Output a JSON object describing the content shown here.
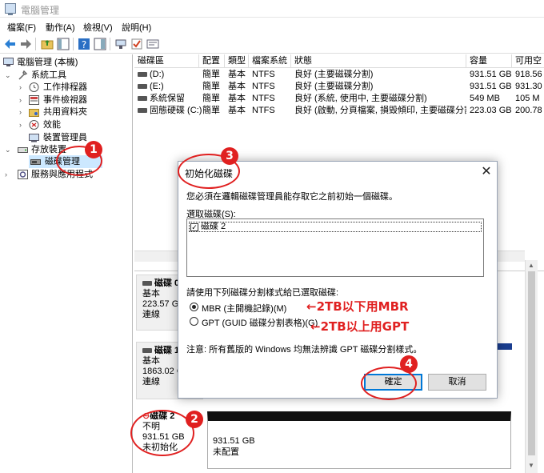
{
  "window": {
    "title": "電腦管理"
  },
  "menu": [
    "檔案(F)",
    "動作(A)",
    "檢視(V)",
    "說明(H)"
  ],
  "toolbar_icons": [
    "back-arrow-icon",
    "forward-arrow-icon",
    "folder-up-icon",
    "show-pane-icon",
    "help-icon",
    "pane-icon",
    "connect-icon",
    "check-icon",
    "properties-icon"
  ],
  "tree": {
    "root": "電腦管理 (本機)",
    "system_tools": "系統工具",
    "task_scheduler": "工作排程器",
    "event_viewer": "事件檢視器",
    "shared_folders": "共用資料夾",
    "performance": "效能",
    "device_manager": "裝置管理員",
    "storage": "存放裝置",
    "disk_management": "磁碟管理",
    "services": "服務與應用程式"
  },
  "volumes": {
    "columns": [
      "磁碟區",
      "配置",
      "類型",
      "檔案系統",
      "狀態",
      "容量",
      "可用空"
    ],
    "rows": [
      [
        "(D:)",
        "簡單",
        "基本",
        "NTFS",
        "良好 (主要磁碟分割)",
        "931.51 GB",
        "918.56"
      ],
      [
        "(E:)",
        "簡單",
        "基本",
        "NTFS",
        "良好 (主要磁碟分割)",
        "931.51 GB",
        "931.30"
      ],
      [
        "系統保留",
        "簡單",
        "基本",
        "NTFS",
        "良好 (系統, 使用中, 主要磁碟分割)",
        "549 MB",
        "105 M"
      ],
      [
        "固態硬碟 (C:)",
        "簡單",
        "基本",
        "NTFS",
        "良好 (啟動, 分頁檔案, 損毀傾印, 主要磁碟分割)",
        "223.03 GB",
        "200.78"
      ]
    ]
  },
  "disks": [
    {
      "name": "磁碟 0",
      "type": "基本",
      "size": "223.57 GE",
      "status": "連線"
    },
    {
      "name": "磁碟 1",
      "type": "基本",
      "size": "1863.02 GE",
      "status": "連線"
    },
    {
      "name": "磁碟 2",
      "type": "不明",
      "size": "931.51 GB",
      "status": "未初始化",
      "part_size": "931.51 GB",
      "part_status": "未配置"
    }
  ],
  "dialog": {
    "title": "初始化磁碟",
    "intro": "您必須在邏輯磁碟管理員能存取它之前初始一個磁碟。",
    "select_label": "選取磁碟(S):",
    "disk_item": "磁碟 2",
    "style_label": "請使用下列磁碟分割樣式給已選取磁碟:",
    "mbr": "MBR (主開機記錄)(M)",
    "gpt": "GPT (GUID 磁碟分割表格)(G)",
    "note": "注意: 所有舊版的 Windows 均無法辨識 GPT 磁碟分割樣式。",
    "ok": "確定",
    "cancel": "取消"
  },
  "annotations": {
    "b1": "1",
    "b2": "2",
    "b3": "3",
    "b4": "4",
    "mbr_hint": "←2TB以下用MBR",
    "gpt_hint": "←2TB以上用GPT",
    "color": "#e02020"
  }
}
